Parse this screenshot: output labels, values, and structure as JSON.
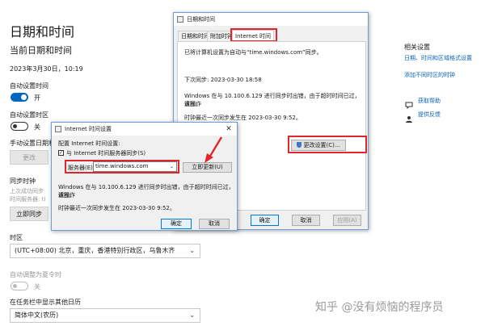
{
  "settings": {
    "title": "日期和时间",
    "current_label": "当前日期和时间",
    "current_value": "2023年3月30日，10:19",
    "auto_time_label": "自动设置时间",
    "auto_time_state": "开",
    "auto_tz_label": "自动设置时区",
    "auto_tz_state": "关",
    "manual_label": "手动设置日期和",
    "change_button": "更改",
    "sync_heading": "同步时钟",
    "sync_line1": "上次成功同步",
    "sync_line2": "时间服务器: ti",
    "sync_now": "立即同步",
    "timezone_label": "时区",
    "timezone_value": "(UTC+08:00) 北京，重庆，香港特别行政区，乌鲁木齐",
    "dst_label": "自动调整为夏令时",
    "dst_state": "关",
    "taskbar_label": "在任务栏中显示其他日历",
    "calendar_value": "简体中文(农历)"
  },
  "related": {
    "heading": "相关设置",
    "link1": "日期、时间和区域格式设置",
    "link2": "添加不同时区的时钟",
    "help": "获取帮助",
    "feedback": "提供反馈"
  },
  "dtdialog": {
    "title": "日期和时间",
    "tabs": [
      "日期和时间",
      "附加时钟",
      "Internet 时间"
    ],
    "sync_info": "已将计算机设置为自动与“time.windows.com”同步。",
    "next_sync": "下次同步: 2023-03-30 18:58",
    "error_line1": "Windows 在与 10.100.6.129 进行同步时出错，由于超时时间已过，该操作",
    "error_line2": "返回。",
    "last_sync": "时钟最近一次同步发生在 2023-03-30 9:52。",
    "change_settings": "更改设置(C)...",
    "ok": "确定",
    "cancel": "取消",
    "apply": "应用(A)"
  },
  "itdialog": {
    "title": "Internet 时间设置",
    "configure": "配置 Internet 时间设置:",
    "checkbox_label": "与 Internet 时间服务器同步(S)",
    "server_label": "服务器(E):",
    "server_value": "time.windows.com",
    "update_now": "立即更新(U)",
    "error_line1": "Windows 在与 10.100.6.129 进行同步时出错，由于超时时间已过，该操作",
    "error_line2": "返回。",
    "last_sync": "时钟最近一次同步发生在 2023-03-30 9:52。",
    "ok": "确定",
    "cancel": "取消"
  },
  "watermark": "知乎 @没有烦恼的程序员",
  "colors": {
    "accent": "#0067c0",
    "highlight": "#e0262b",
    "link": "#0a63b8"
  }
}
